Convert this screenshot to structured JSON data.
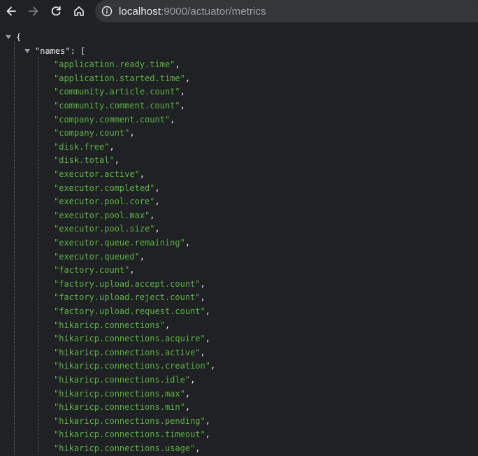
{
  "browser": {
    "url_host": "localhost",
    "url_rest": ":9000/actuator/metrics"
  },
  "json_view": {
    "open_brace": "{",
    "key": "\"names\"",
    "key_sep": ": [",
    "items": [
      "\"application.ready.time\"",
      "\"application.started.time\"",
      "\"community.article.count\"",
      "\"community.comment.count\"",
      "\"company.comment.count\"",
      "\"company.count\"",
      "\"disk.free\"",
      "\"disk.total\"",
      "\"executor.active\"",
      "\"executor.completed\"",
      "\"executor.pool.core\"",
      "\"executor.pool.max\"",
      "\"executor.pool.size\"",
      "\"executor.queue.remaining\"",
      "\"executor.queued\"",
      "\"factory.count\"",
      "\"factory.upload.accept.count\"",
      "\"factory.upload.reject.count\"",
      "\"factory.upload.request.count\"",
      "\"hikaricp.connections\"",
      "\"hikaricp.connections.acquire\"",
      "\"hikaricp.connections.active\"",
      "\"hikaricp.connections.creation\"",
      "\"hikaricp.connections.idle\"",
      "\"hikaricp.connections.max\"",
      "\"hikaricp.connections.min\"",
      "\"hikaricp.connections.pending\"",
      "\"hikaricp.connections.timeout\"",
      "\"hikaricp.connections.usage\""
    ],
    "item_sep": ","
  }
}
